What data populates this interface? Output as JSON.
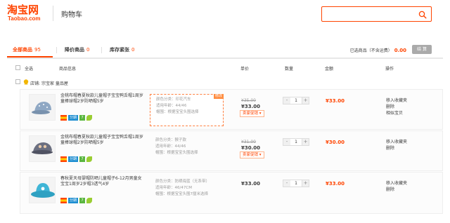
{
  "header": {
    "logo_cn": "淘宝网",
    "logo_en": "Taobao.com",
    "title": "购物车",
    "search_value": ""
  },
  "tabs": [
    {
      "label": "全部商品",
      "count": "95",
      "active": true
    },
    {
      "label": "降价商品",
      "count": "0",
      "active": false
    },
    {
      "label": "库存紧张",
      "count": "0",
      "active": false
    }
  ],
  "summary": {
    "label": "已选商品（不含运费）",
    "amount": "0.00",
    "settle": "结 算"
  },
  "columns": {
    "select_all": "全选",
    "info": "商品信息",
    "price": "单价",
    "qty": "数量",
    "amount": "金额",
    "ops": "操作"
  },
  "shop": {
    "prefix": "店铺:",
    "name": "宗宝家 童品屋"
  },
  "items": [
    {
      "title": "金桃布帽春夏秋款儿童帽子宝宝鸭舌帽1周岁童棒球帽2岁防晒帽5岁",
      "spec_color": "颜色分类：印花汽车",
      "spec_age": "适用年龄：44/46",
      "spec_size": "帽围：根据宝宝头围选择",
      "old_price": "¥35.00",
      "price": "¥33.00",
      "promo": "卖家促销",
      "qty": "1",
      "sum": "¥33.00",
      "op1": "移入收藏夹",
      "op2": "删除",
      "op3": "相似宝贝",
      "hover_edit": "修改",
      "hat_color": "#8fa8c4"
    },
    {
      "title": "金桃布帽春夏秋款儿童帽子宝宝鸭舌帽1周岁童棒球帽2岁防晒帽5岁",
      "spec_color": "颜色分类：猴子款",
      "spec_age": "适用年龄：44/46",
      "spec_size": "帽围：根据宝宝头围选择",
      "old_price": "¥31.00",
      "price": "¥30.00",
      "promo": "卖家促销",
      "qty": "1",
      "sum": "¥30.00",
      "op1": "移入收藏夹",
      "op2": "删除",
      "op3": "",
      "hover_edit": "",
      "hat_color": "#6b6f80"
    },
    {
      "title": "春秋夏天母婴帽防晒儿童帽子6-12月男童女宝宝1周岁2岁帽3透气4岁",
      "spec_color": "颜色分类：防晒海蓝（无系带）",
      "spec_age": "适用年龄：46/47CM",
      "spec_size": "帽围：根据宝宝头围7厘米选择",
      "old_price": "",
      "price": "¥33.00",
      "promo": "",
      "qty": "1",
      "sum": "¥33.00",
      "op1": "移入收藏夹",
      "op2": "删除",
      "op3": "",
      "hover_edit": "",
      "hat_color": "#3fb5d6"
    }
  ],
  "badges": {
    "fenqi": "分期",
    "seven": "7"
  },
  "colors": {
    "brand": "#ff4400",
    "settle_disabled": "#aaaaaa"
  }
}
